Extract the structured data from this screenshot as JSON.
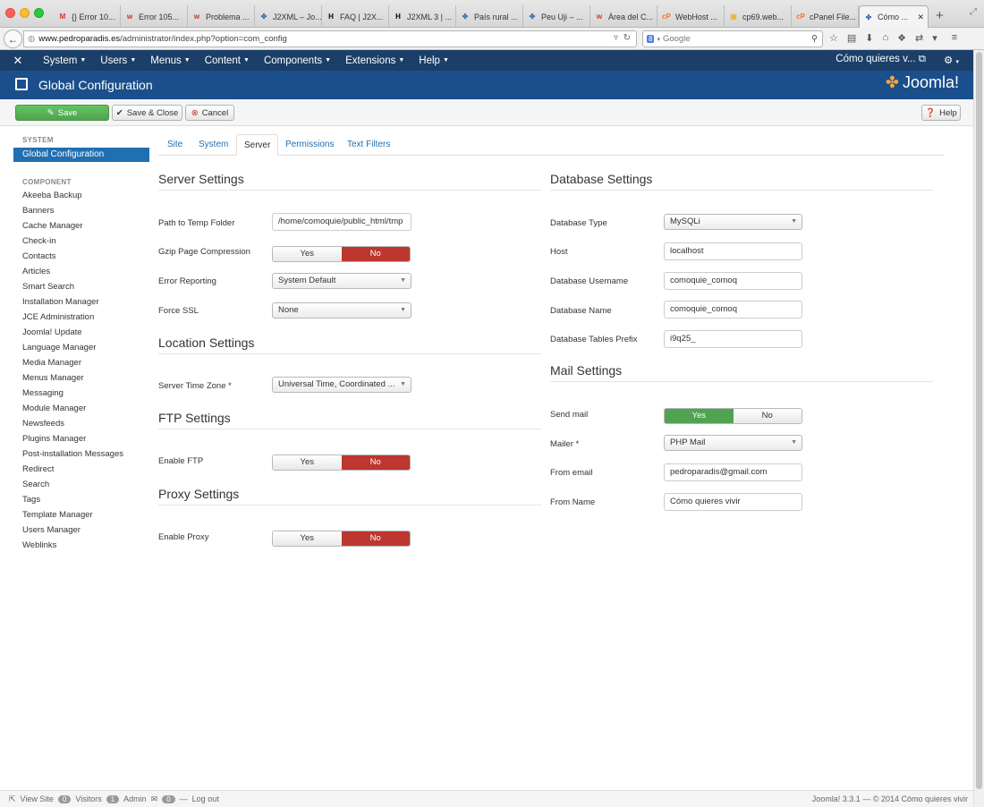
{
  "browser": {
    "tabs": [
      {
        "label": "{} Error 10...",
        "icon": "gmail-icon",
        "color": "#d93025"
      },
      {
        "label": "Error 105...",
        "icon": "w-icon",
        "color": "#c0392b"
      },
      {
        "label": "Problema ...",
        "icon": "w-icon",
        "color": "#c0392b"
      },
      {
        "label": "J2XML – Jo...",
        "icon": "joomla-icon",
        "color": "#3b6fb6"
      },
      {
        "label": "FAQ | J2X...",
        "icon": "j2xml-icon",
        "color": "#000000"
      },
      {
        "label": "J2XML 3 | ...",
        "icon": "j2xml-icon",
        "color": "#000000"
      },
      {
        "label": "País rural ...",
        "icon": "joomla-icon",
        "color": "#3b6fb6"
      },
      {
        "label": "Peu Uji – ...",
        "icon": "joomla-icon",
        "color": "#3b6fb6"
      },
      {
        "label": "Àrea del C...",
        "icon": "w-icon",
        "color": "#c0392b"
      },
      {
        "label": "WebHost ...",
        "icon": "cpanel-icon",
        "color": "#ff6c2c"
      },
      {
        "label": "cp69.web...",
        "icon": "web-icon",
        "color": "#e8b43a"
      },
      {
        "label": "cPanel File...",
        "icon": "cpanel-icon",
        "color": "#ff6c2c"
      },
      {
        "label": "Cómo ...",
        "icon": "joomla-icon",
        "color": "#3b6fb6"
      }
    ],
    "url_host": "www.pedroparadis.es",
    "url_path": "/administrator/index.php?option=com_config",
    "search_placeholder": "Google"
  },
  "nav": {
    "items": [
      "System",
      "Users",
      "Menus",
      "Content",
      "Components",
      "Extensions",
      "Help"
    ],
    "site_name": "Cómo quieres v..."
  },
  "header": {
    "title": "Global Configuration",
    "brand": "Joomla!"
  },
  "toolbar": {
    "save": "Save",
    "save_close": "Save & Close",
    "cancel": "Cancel",
    "help": "Help"
  },
  "sidebar": {
    "system_heading": "SYSTEM",
    "active_item": "Global Configuration",
    "component_heading": "COMPONENT",
    "items": [
      "Akeeba Backup",
      "Banners",
      "Cache Manager",
      "Check-in",
      "Contacts",
      "Articles",
      "Smart Search",
      "Installation Manager",
      "JCE Administration",
      "Joomla! Update",
      "Language Manager",
      "Media Manager",
      "Menus Manager",
      "Messaging",
      "Module Manager",
      "Newsfeeds",
      "Plugins Manager",
      "Post-installation Messages",
      "Redirect",
      "Search",
      "Tags",
      "Template Manager",
      "Users Manager",
      "Weblinks"
    ]
  },
  "tabs": [
    "Site",
    "System",
    "Server",
    "Permissions",
    "Text Filters"
  ],
  "server": {
    "heading": "Server Settings",
    "temp_label": "Path to Temp Folder",
    "temp_value": "/home/comoquie/public_html/tmp",
    "gzip_label": "Gzip Page Compression",
    "error_label": "Error Reporting",
    "error_value": "System Default",
    "ssl_label": "Force SSL",
    "ssl_value": "None"
  },
  "location": {
    "heading": "Location Settings",
    "tz_label": "Server Time Zone *",
    "tz_value": "Universal Time, Coordinated ..."
  },
  "ftp": {
    "heading": "FTP Settings",
    "enable_label": "Enable FTP"
  },
  "proxy": {
    "heading": "Proxy Settings",
    "enable_label": "Enable Proxy"
  },
  "database": {
    "heading": "Database Settings",
    "type_label": "Database Type",
    "type_value": "MySQLi",
    "host_label": "Host",
    "host_value": "localhost",
    "user_label": "Database Username",
    "user_value": "comoquie_comoq",
    "name_label": "Database Name",
    "name_value": "comoquie_comoq",
    "prefix_label": "Database Tables Prefix",
    "prefix_value": "i9q25_"
  },
  "mail": {
    "heading": "Mail Settings",
    "send_label": "Send mail",
    "mailer_label": "Mailer *",
    "mailer_value": "PHP Mail",
    "from_email_label": "From email",
    "from_email_value": "pedroparadis@gmail.com",
    "from_name_label": "From Name",
    "from_name_value": "Cómo quieres vivir"
  },
  "toggle": {
    "yes": "Yes",
    "no": "No"
  },
  "footer": {
    "view_site": "View Site",
    "visitors_count": "0",
    "visitors": "Visitors",
    "admin_count": "1",
    "admin": "Admin",
    "messages_count": "0",
    "logout": "Log out",
    "version": "Joomla! 3.3.1  —  © 2014 Cómo quieres vivir"
  }
}
